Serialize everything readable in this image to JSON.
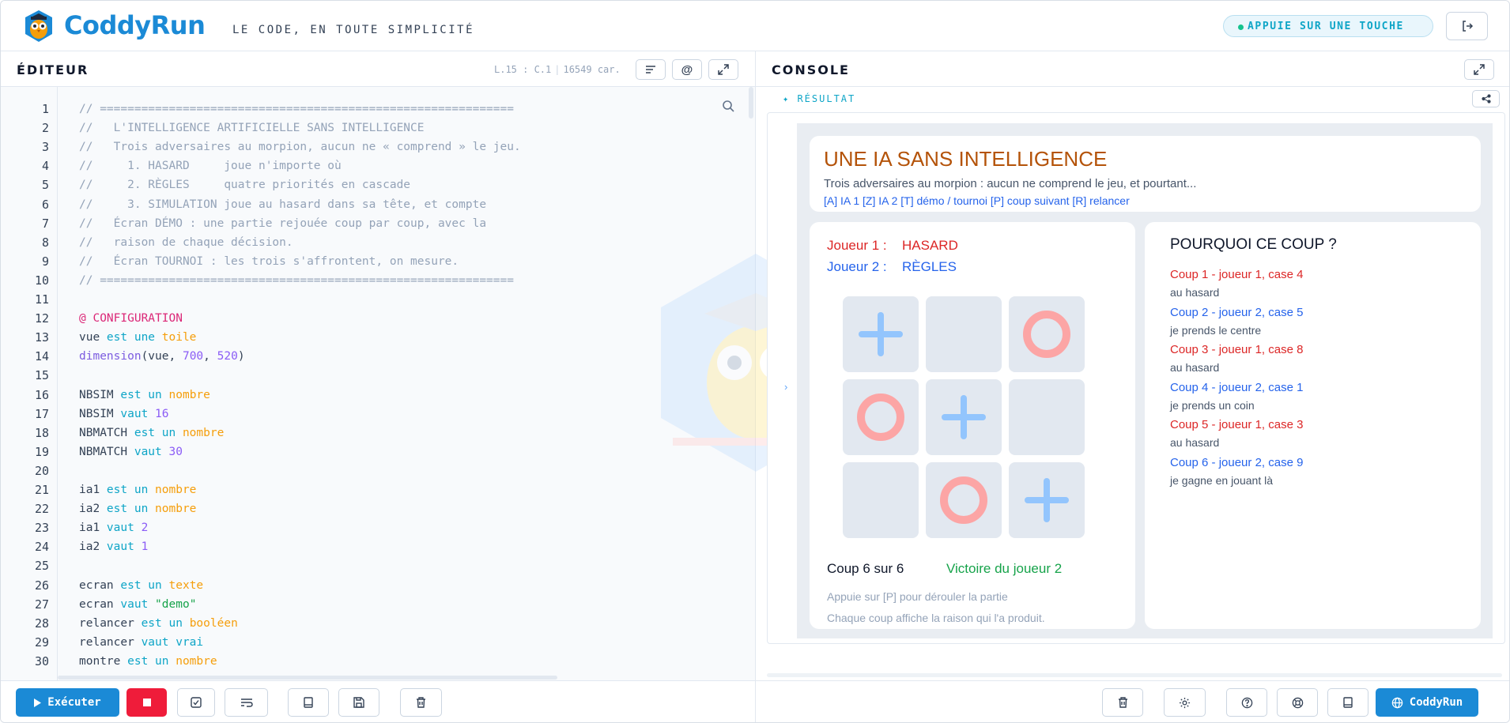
{
  "header": {
    "brand": "CoddyRun",
    "tagline": "LE CODE, EN TOUTE SIMPLICITÉ",
    "status": "APPUIE SUR UNE TOUCHE",
    "logo_icon": "owl-logo-icon",
    "logout_icon": "logout-icon"
  },
  "editor": {
    "title": "ÉDITEUR",
    "position": "L.15 : C.1",
    "chars": "16549 car.",
    "buttons": [
      "format-icon",
      "at-icon",
      "expand-icon"
    ],
    "lines": [
      {
        "n": "1",
        "parts": [
          {
            "t": "// ============================================================",
            "c": "cm"
          }
        ]
      },
      {
        "n": "2",
        "parts": [
          {
            "t": "//   L'INTELLIGENCE ARTIFICIELLE SANS INTELLIGENCE",
            "c": "cm"
          }
        ]
      },
      {
        "n": "3",
        "parts": [
          {
            "t": "//   Trois adversaires au morpion, aucun ne « comprend » le jeu.",
            "c": "cm"
          }
        ]
      },
      {
        "n": "4",
        "parts": [
          {
            "t": "//     1. HASARD     joue n'importe où",
            "c": "cm"
          }
        ]
      },
      {
        "n": "5",
        "parts": [
          {
            "t": "//     2. RÈGLES     quatre priorités en cascade",
            "c": "cm"
          }
        ]
      },
      {
        "n": "6",
        "parts": [
          {
            "t": "//     3. SIMULATION joue au hasard dans sa tête, et compte",
            "c": "cm"
          }
        ]
      },
      {
        "n": "7",
        "parts": [
          {
            "t": "//   Écran DÉMO : une partie rejouée coup par coup, avec la",
            "c": "cm"
          }
        ]
      },
      {
        "n": "8",
        "parts": [
          {
            "t": "//   raison de chaque décision.",
            "c": "cm"
          }
        ]
      },
      {
        "n": "9",
        "parts": [
          {
            "t": "//   Écran TOURNOI : les trois s'affrontent, on mesure.",
            "c": "cm"
          }
        ]
      },
      {
        "n": "10",
        "parts": [
          {
            "t": "// ============================================================",
            "c": "cm"
          }
        ]
      },
      {
        "n": "11",
        "parts": []
      },
      {
        "n": "12",
        "parts": [
          {
            "t": "@ CONFIGURATION",
            "c": "at"
          }
        ]
      },
      {
        "n": "13",
        "parts": [
          {
            "t": "vue ",
            "c": "pl"
          },
          {
            "t": "est une ",
            "c": "kw"
          },
          {
            "t": "toile",
            "c": "ty"
          }
        ]
      },
      {
        "n": "14",
        "parts": [
          {
            "t": "dimension",
            "c": "fn"
          },
          {
            "t": "(vue, ",
            "c": "pl"
          },
          {
            "t": "700",
            "c": "num"
          },
          {
            "t": ", ",
            "c": "pl"
          },
          {
            "t": "520",
            "c": "num"
          },
          {
            "t": ")",
            "c": "pl"
          }
        ]
      },
      {
        "n": "15",
        "parts": []
      },
      {
        "n": "16",
        "parts": [
          {
            "t": "NBSIM ",
            "c": "pl"
          },
          {
            "t": "est un ",
            "c": "kw"
          },
          {
            "t": "nombre",
            "c": "ty"
          }
        ]
      },
      {
        "n": "17",
        "parts": [
          {
            "t": "NBSIM ",
            "c": "pl"
          },
          {
            "t": "vaut ",
            "c": "kw"
          },
          {
            "t": "16",
            "c": "num"
          }
        ]
      },
      {
        "n": "18",
        "parts": [
          {
            "t": "NBMATCH ",
            "c": "pl"
          },
          {
            "t": "est un ",
            "c": "kw"
          },
          {
            "t": "nombre",
            "c": "ty"
          }
        ]
      },
      {
        "n": "19",
        "parts": [
          {
            "t": "NBMATCH ",
            "c": "pl"
          },
          {
            "t": "vaut ",
            "c": "kw"
          },
          {
            "t": "30",
            "c": "num"
          }
        ]
      },
      {
        "n": "20",
        "parts": []
      },
      {
        "n": "21",
        "parts": [
          {
            "t": "ia1 ",
            "c": "pl"
          },
          {
            "t": "est un ",
            "c": "kw"
          },
          {
            "t": "nombre",
            "c": "ty"
          }
        ]
      },
      {
        "n": "22",
        "parts": [
          {
            "t": "ia2 ",
            "c": "pl"
          },
          {
            "t": "est un ",
            "c": "kw"
          },
          {
            "t": "nombre",
            "c": "ty"
          }
        ]
      },
      {
        "n": "23",
        "parts": [
          {
            "t": "ia1 ",
            "c": "pl"
          },
          {
            "t": "vaut ",
            "c": "kw"
          },
          {
            "t": "2",
            "c": "num"
          }
        ]
      },
      {
        "n": "24",
        "parts": [
          {
            "t": "ia2 ",
            "c": "pl"
          },
          {
            "t": "vaut ",
            "c": "kw"
          },
          {
            "t": "1",
            "c": "num"
          }
        ]
      },
      {
        "n": "25",
        "parts": []
      },
      {
        "n": "26",
        "parts": [
          {
            "t": "ecran ",
            "c": "pl"
          },
          {
            "t": "est un ",
            "c": "kw"
          },
          {
            "t": "texte",
            "c": "ty"
          }
        ]
      },
      {
        "n": "27",
        "parts": [
          {
            "t": "ecran ",
            "c": "pl"
          },
          {
            "t": "vaut ",
            "c": "kw"
          },
          {
            "t": "\"demo\"",
            "c": "str"
          }
        ]
      },
      {
        "n": "28",
        "parts": [
          {
            "t": "relancer ",
            "c": "pl"
          },
          {
            "t": "est un ",
            "c": "kw"
          },
          {
            "t": "booléen",
            "c": "ty"
          }
        ]
      },
      {
        "n": "29",
        "parts": [
          {
            "t": "relancer ",
            "c": "pl"
          },
          {
            "t": "vaut vrai",
            "c": "kw"
          }
        ]
      },
      {
        "n": "30",
        "parts": [
          {
            "t": "montre ",
            "c": "pl"
          },
          {
            "t": "est un ",
            "c": "kw"
          },
          {
            "t": "nombre",
            "c": "ty"
          }
        ]
      }
    ]
  },
  "console": {
    "title": "CONSOLE",
    "result_label": "✦ RÉSULTAT",
    "game": {
      "title": "UNE IA SANS INTELLIGENCE",
      "subtitle": "Trois adversaires au morpion : aucun ne comprend le jeu, et pourtant...",
      "keys": "[A] IA 1 [Z] IA 2 [T] démo / tournoi [P] coup suivant [R] relancer",
      "player1_label": "Joueur 1 :",
      "player1_name": "HASARD",
      "player2_label": "Joueur 2 :",
      "player2_name": "RÈGLES",
      "board": [
        "x",
        "",
        "o",
        "o",
        "x",
        "",
        "",
        "o",
        "x"
      ],
      "move_count": "Coup 6 sur 6",
      "result": "Victoire du joueur 2",
      "hint1": "Appuie sur [P] pour dérouler la partie",
      "hint2": "Chaque coup affiche la raison qui l'a produit.",
      "why_title": "POURQUOI CE COUP ?",
      "moves": [
        {
          "move": "Coup 1 - joueur 1, case 4",
          "reason": "au hasard",
          "player": 1
        },
        {
          "move": "Coup 2 - joueur 2, case 5",
          "reason": "je prends le centre",
          "player": 2
        },
        {
          "move": "Coup 3 - joueur 1, case 8",
          "reason": "au hasard",
          "player": 1
        },
        {
          "move": "Coup 4 - joueur 2, case 1",
          "reason": "je prends un coin",
          "player": 2
        },
        {
          "move": "Coup 5 - joueur 1, case 3",
          "reason": "au hasard",
          "player": 1
        },
        {
          "move": "Coup 6 - joueur 2, case 9",
          "reason": "je gagne en jouant là",
          "player": 2
        }
      ]
    }
  },
  "footer": {
    "run_label": "Exécuter",
    "coddy_label": "CoddyRun",
    "left_icons": [
      "check-icon",
      "wrap-icon",
      "book-icon",
      "save-icon",
      "trash-icon"
    ],
    "right_icons": [
      "trash-icon",
      "settings-icon",
      "help-icon",
      "support-icon",
      "book-icon"
    ]
  },
  "colors": {
    "brand": "#1b8ad6",
    "stop": "#ef1c3a",
    "player1": "#dc2626",
    "player2": "#2563eb"
  }
}
